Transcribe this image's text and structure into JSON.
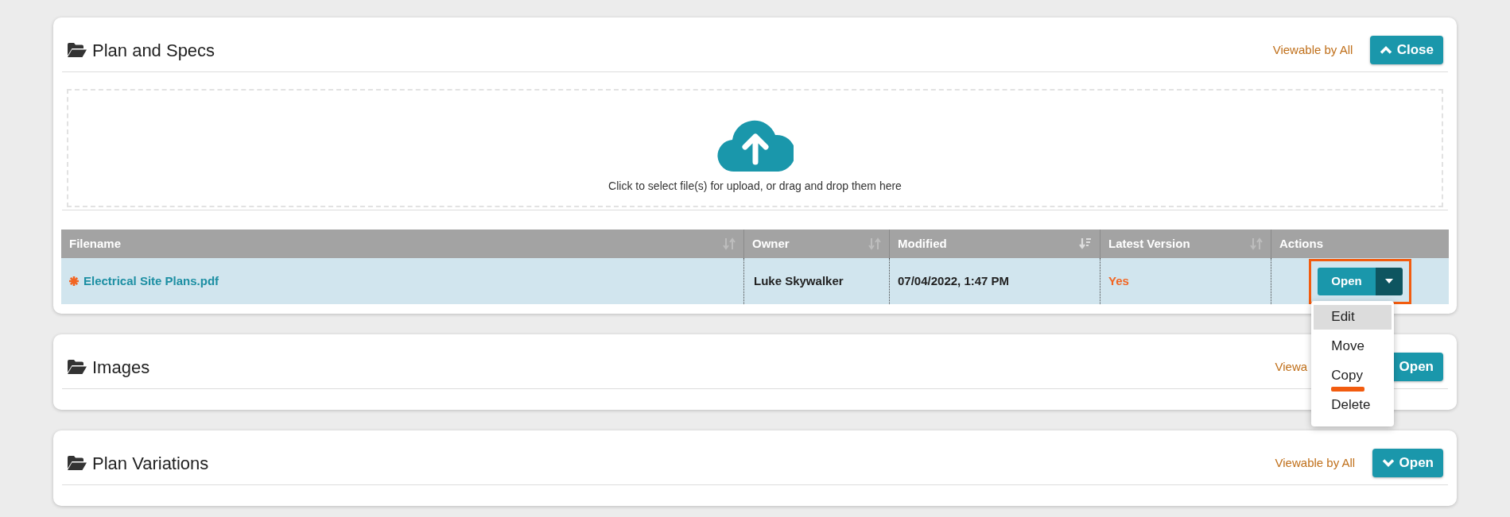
{
  "panels": [
    {
      "title": "Plan and Specs",
      "visibility": "Viewable by All",
      "expanded": true,
      "button": {
        "label": "Close",
        "kind": "collapse"
      },
      "upload": {
        "text": "Click to select file(s) for upload, or drag and drop them here"
      },
      "table": {
        "columns": [
          {
            "label": "Filename",
            "sortable": true,
            "sorted": false
          },
          {
            "label": "Owner",
            "sortable": true,
            "sorted": false
          },
          {
            "label": "Modified",
            "sortable": true,
            "sorted": true
          },
          {
            "label": "Latest Version",
            "sortable": true,
            "sorted": false
          },
          {
            "label": "Actions",
            "sortable": false
          }
        ],
        "rows": [
          {
            "selected": true,
            "starred": true,
            "filename": "Electrical Site Plans.pdf",
            "owner": "Luke Skywalker",
            "modified": "07/04/2022, 1:47 PM",
            "latest": "Yes",
            "action": {
              "label": "Open",
              "highlighted": true,
              "menu": [
                {
                  "label": "Edit",
                  "selected": true,
                  "underlined": false
                },
                {
                  "label": "Move",
                  "selected": false,
                  "underlined": false
                },
                {
                  "label": "Copy",
                  "selected": false,
                  "underlined": true
                },
                {
                  "label": "Delete",
                  "selected": false,
                  "underlined": false
                }
              ]
            }
          }
        ]
      }
    },
    {
      "title": "Images",
      "visibility": "Viewa",
      "expanded": false,
      "button": {
        "label": "Open",
        "kind": "text"
      }
    },
    {
      "title": "Plan Variations",
      "visibility": "Viewable by All",
      "expanded": false,
      "button": {
        "label": "Open",
        "kind": "expand"
      }
    }
  ]
}
